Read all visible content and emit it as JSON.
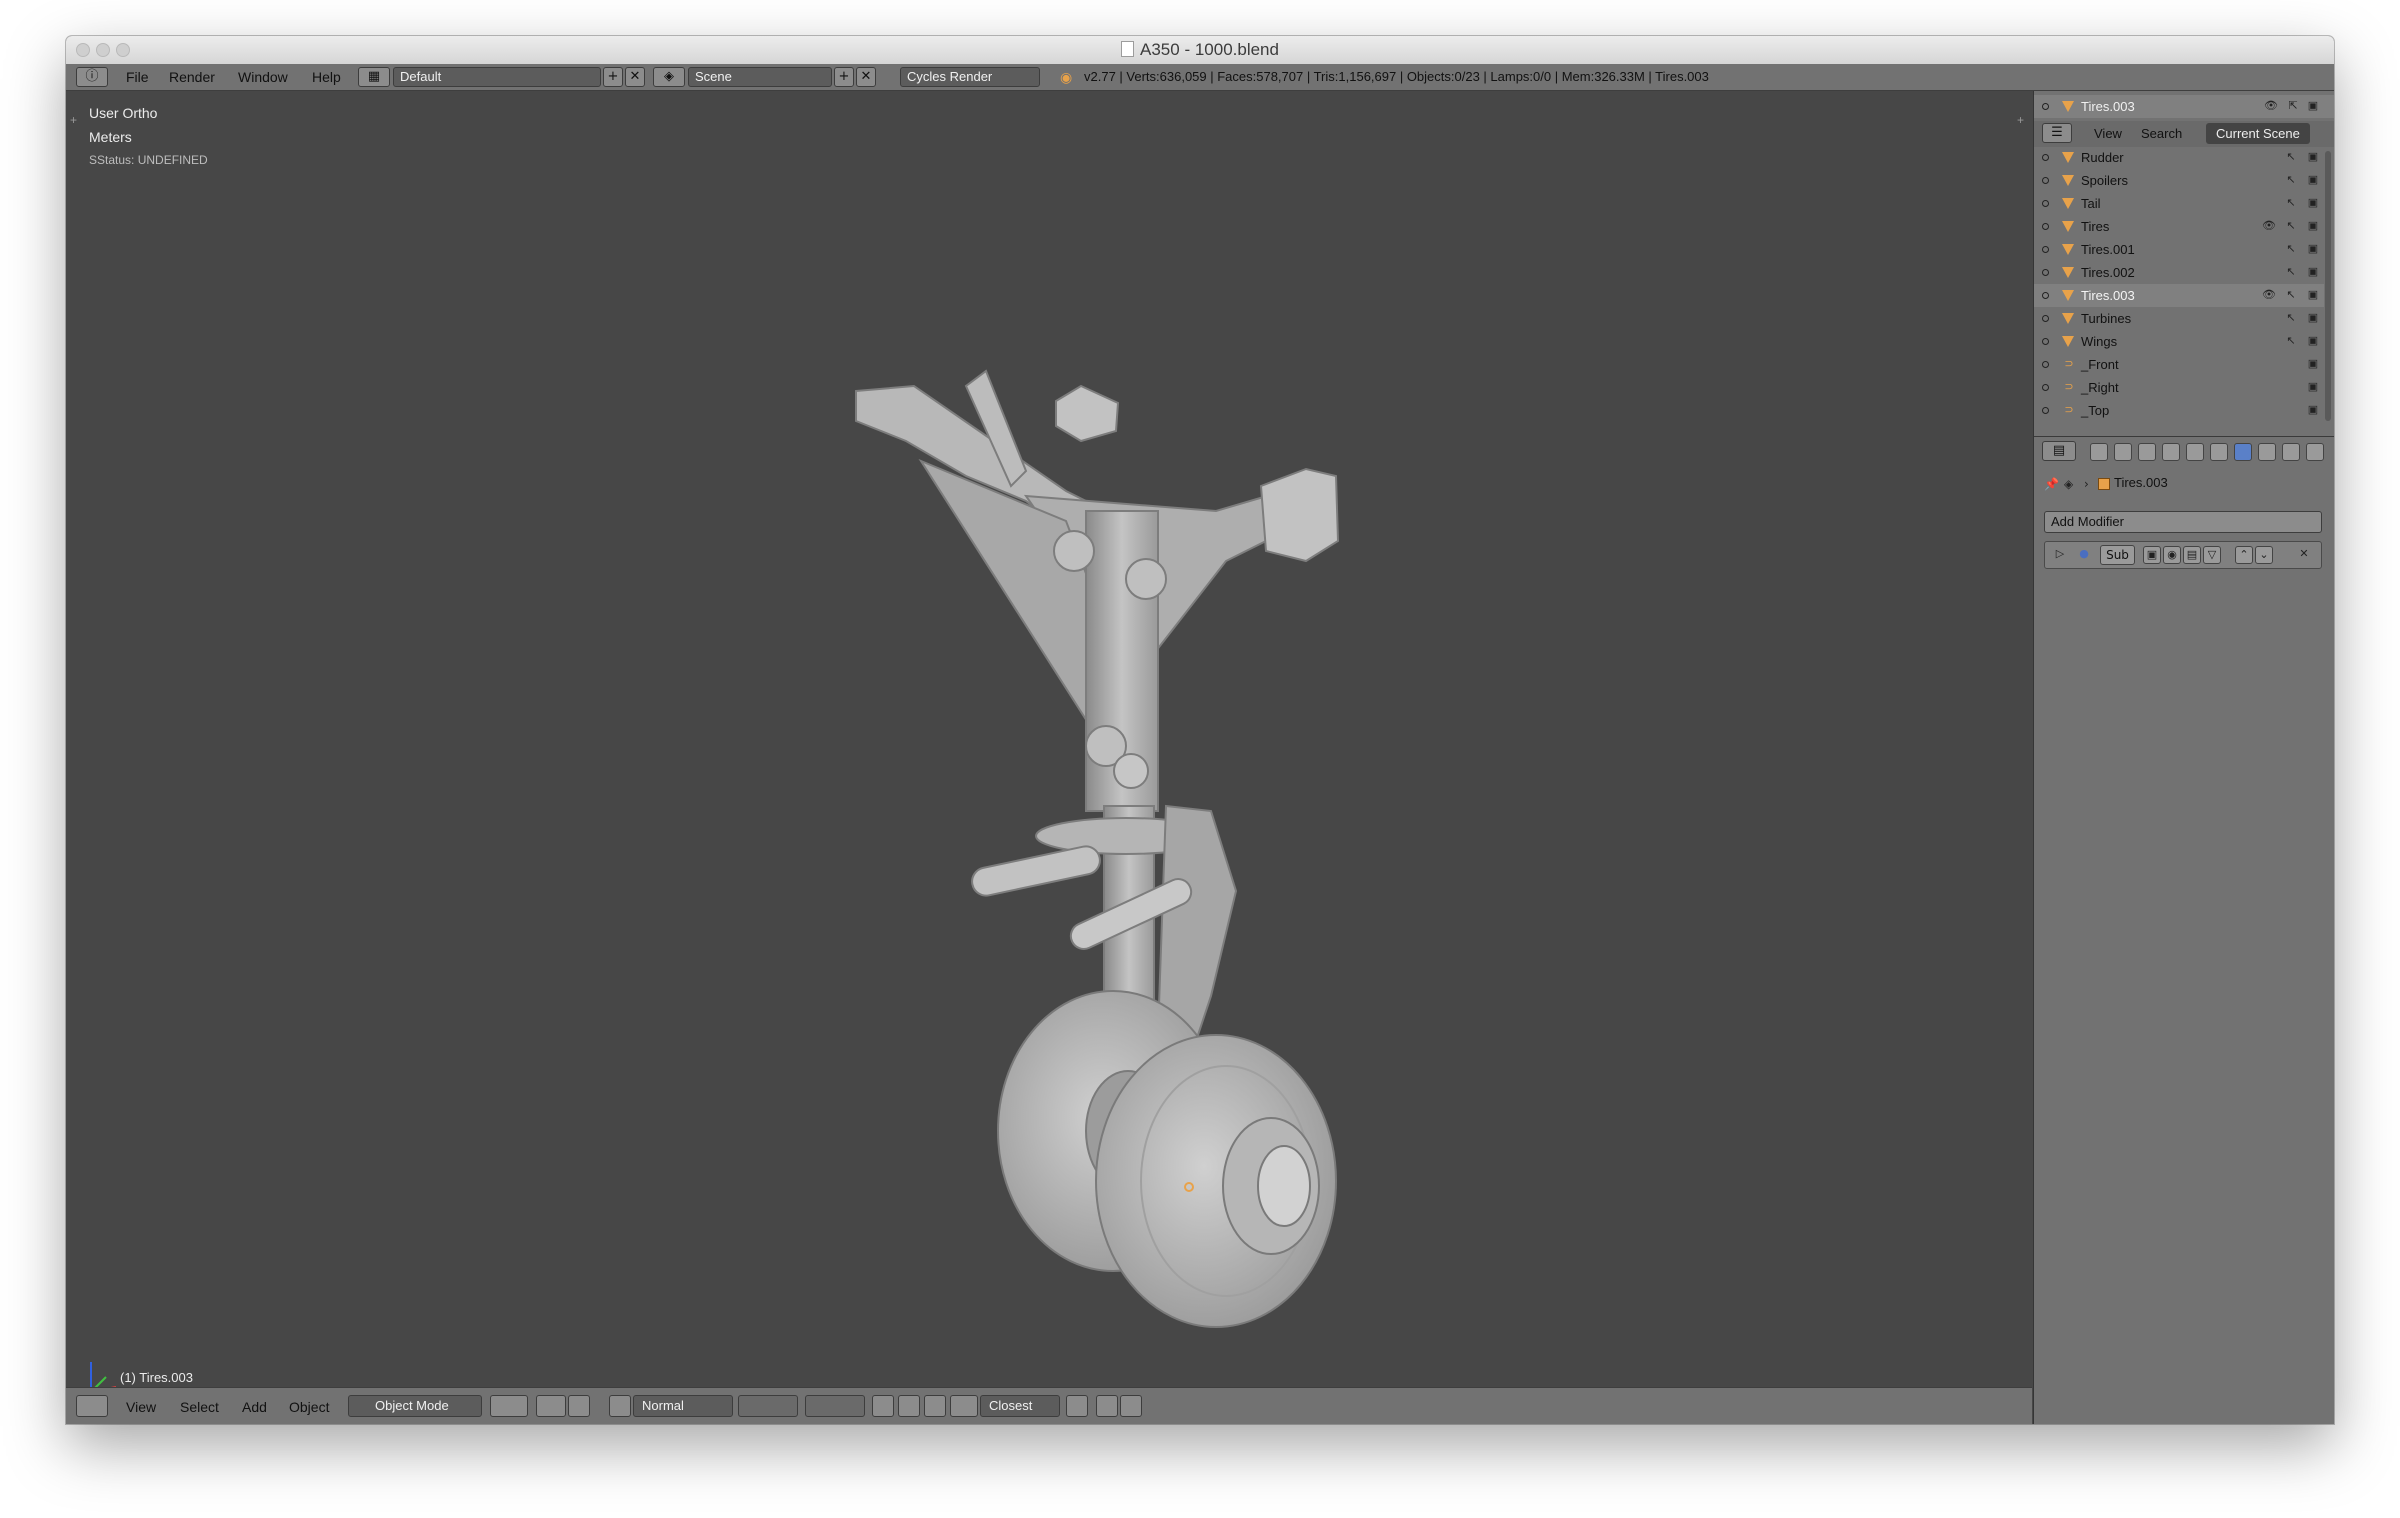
{
  "window": {
    "title": "A350 - 1000.blend"
  },
  "topbar": {
    "menus": [
      "File",
      "Render",
      "Window",
      "Help"
    ],
    "screen_layout": "Default",
    "scene": "Scene",
    "render_engine": "Cycles Render",
    "stats": "v2.77 | Verts:636,059 | Faces:578,707 | Tris:1,156,697 | Objects:0/23 | Lamps:0/0 | Mem:326.33M | Tires.003"
  },
  "viewport": {
    "view_name": "User Ortho",
    "units": "Meters",
    "status": "SStatus: UNDEFINED",
    "active_object": "(1) Tires.003",
    "model": "landing-gear"
  },
  "bottombar": {
    "menus": [
      "View",
      "Select",
      "Add",
      "Object"
    ],
    "mode": "Object Mode",
    "orientation": "Normal",
    "snap_target": "Closest"
  },
  "outliner": {
    "header_object": "Tires.003",
    "tabs": [
      "View",
      "Search",
      "Current Scene"
    ],
    "items": [
      {
        "name": "Rudder",
        "type": "mesh"
      },
      {
        "name": "Spoilers",
        "type": "mesh"
      },
      {
        "name": "Tail",
        "type": "mesh"
      },
      {
        "name": "Tires",
        "type": "mesh",
        "visible": true
      },
      {
        "name": "Tires.001",
        "type": "mesh"
      },
      {
        "name": "Tires.002",
        "type": "mesh"
      },
      {
        "name": "Tires.003",
        "type": "mesh",
        "visible": true,
        "selected": true
      },
      {
        "name": "Turbines",
        "type": "mesh"
      },
      {
        "name": "Wings",
        "type": "mesh"
      },
      {
        "name": "_Front",
        "type": "camera"
      },
      {
        "name": "_Right",
        "type": "camera"
      },
      {
        "name": "_Top",
        "type": "camera"
      }
    ]
  },
  "properties": {
    "context_object": "Tires.003",
    "add_modifier": "Add Modifier",
    "modifier_name": "Sub"
  },
  "colors": {
    "mesh_accent": "#e8a24a",
    "viewport_bg": "#474747",
    "panel_bg": "#727272"
  }
}
